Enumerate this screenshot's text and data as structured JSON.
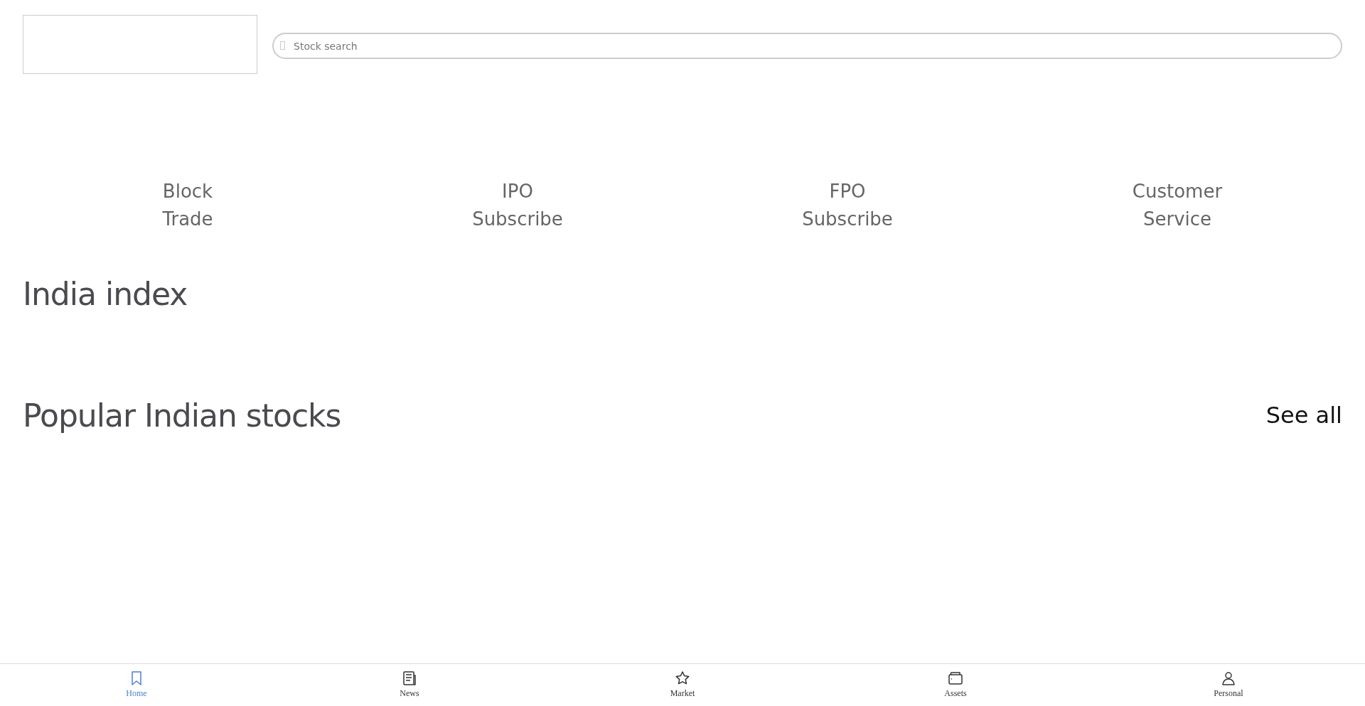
{
  "search": {
    "placeholder": "Stock search"
  },
  "quick_links": [
    {
      "line1": "Block",
      "line2": "Trade"
    },
    {
      "line1": "IPO",
      "line2": "Subscribe"
    },
    {
      "line1": "FPO",
      "line2": "Subscribe"
    },
    {
      "line1": "Customer",
      "line2": "Service"
    }
  ],
  "sections": [
    {
      "title": "India index"
    },
    {
      "title": "Popular Indian stocks",
      "link": "See all"
    }
  ],
  "bottom_nav": [
    {
      "label": "Home",
      "selected": true
    },
    {
      "label": "News",
      "selected": false
    },
    {
      "label": "Market",
      "selected": false
    },
    {
      "label": "Assets",
      "selected": false
    },
    {
      "label": "Personal",
      "selected": false
    }
  ]
}
